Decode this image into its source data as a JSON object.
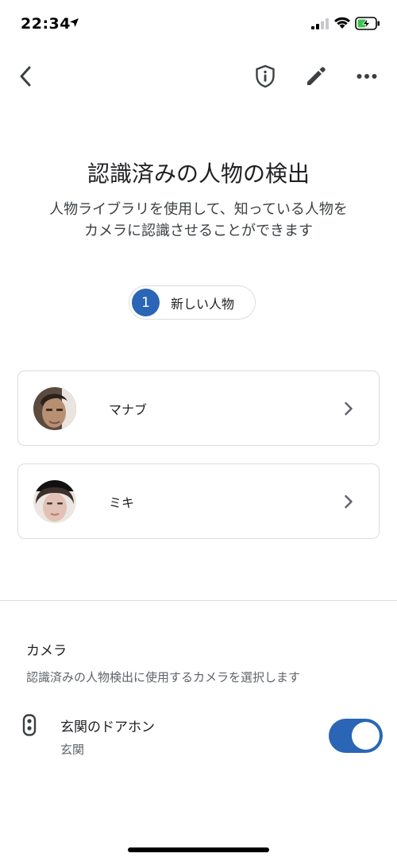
{
  "status_bar": {
    "time": "22:34"
  },
  "app_bar": {
    "back_icon": "chevron-left-icon",
    "privacy_icon": "shield-info-icon",
    "edit_icon": "pencil-icon",
    "more_icon": "more-horiz-icon"
  },
  "header": {
    "title": "認識済みの人物の検出",
    "description_line1": "人物ライブラリを使用して、知っている人物を",
    "description_line2": "カメラに認識させることができます"
  },
  "new_people": {
    "count": "1",
    "label": "新しい人物"
  },
  "people": [
    {
      "name": "マナブ",
      "avatar": "face-photo-manabu"
    },
    {
      "name": "ミキ",
      "avatar": "face-photo-miki"
    }
  ],
  "camera_section": {
    "heading": "カメラ",
    "description": "認識済みの人物検出に使用するカメラを選択します",
    "devices": [
      {
        "name": "玄関のドアホン",
        "location": "玄関",
        "enabled": true,
        "icon": "doorbell-icon"
      }
    ]
  },
  "colors": {
    "accent": "#2a66b5",
    "border": "#dadce0",
    "text": "#202124",
    "secondary_text": "#5f6368"
  }
}
